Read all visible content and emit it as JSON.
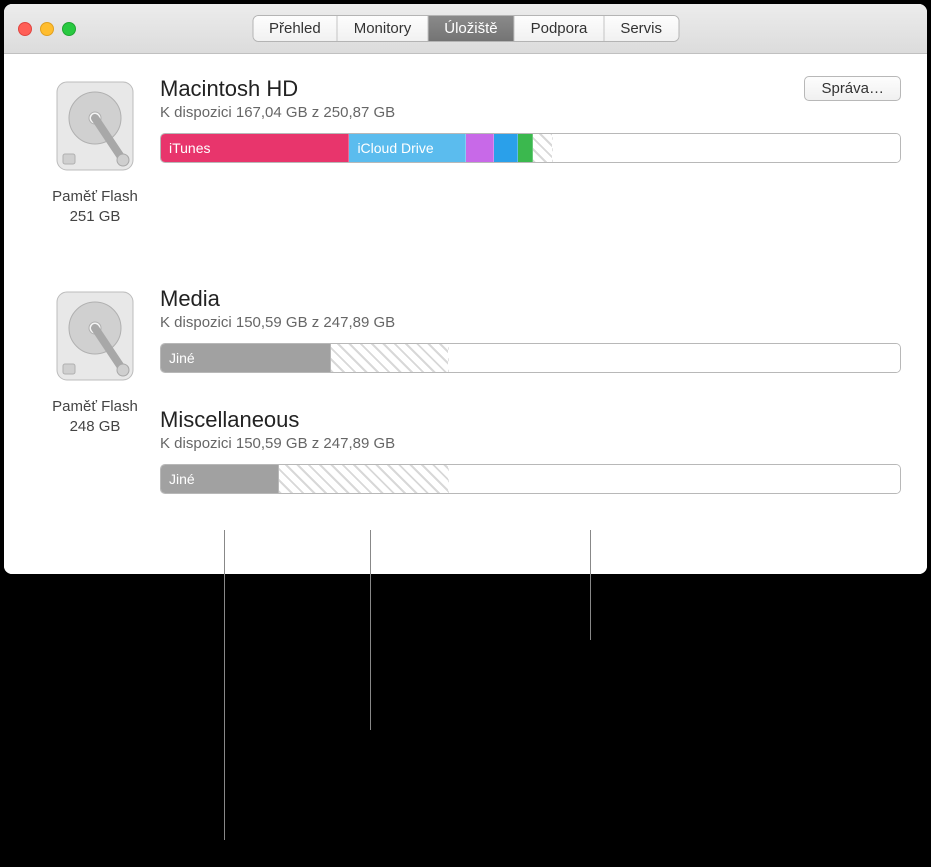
{
  "tabs": {
    "overview": "Přehled",
    "monitors": "Monitory",
    "storage": "Úložiště",
    "support": "Podpora",
    "service": "Servis"
  },
  "manage_button": "Správa…",
  "disk1": {
    "icon_label_line1": "Paměť Flash",
    "icon_label_line2": "251 GB",
    "volume": {
      "name": "Macintosh HD",
      "available": "K dispozici 167,04 GB z 250,87 GB",
      "segments": [
        {
          "label": "iTunes",
          "color": "#e8356c",
          "width": "25.5%"
        },
        {
          "label": "iCloud Drive",
          "color": "#5bbcee",
          "width": "15.8%"
        },
        {
          "label": "",
          "color": "#c869e8",
          "width": "3.8%"
        },
        {
          "label": "",
          "color": "#2aa0ea",
          "width": "3.2%"
        },
        {
          "label": "",
          "color": "#3bb84e",
          "width": "2.0%"
        },
        {
          "label": "",
          "color": "hatch",
          "width": "2.8%"
        },
        {
          "label": "",
          "color": "free",
          "width": "46.9%"
        }
      ]
    }
  },
  "disk2": {
    "icon_label_line1": "Paměť Flash",
    "icon_label_line2": "248 GB",
    "volumes": [
      {
        "name": "Media",
        "available": "K dispozici 150,59 GB z 247,89 GB",
        "segments": [
          {
            "label": "Jiné",
            "color": "#a1a1a1",
            "width": "23%"
          },
          {
            "label": "",
            "color": "hatch",
            "width": "16%"
          },
          {
            "label": "",
            "color": "free",
            "width": "61%"
          }
        ]
      },
      {
        "name": "Miscellaneous",
        "available": "K dispozici 150,59 GB z 247,89 GB",
        "segments": [
          {
            "label": "Jiné",
            "color": "#a1a1a1",
            "width": "16%"
          },
          {
            "label": "",
            "color": "hatch",
            "width": "23%"
          },
          {
            "label": "",
            "color": "free",
            "width": "61%"
          }
        ]
      }
    ]
  }
}
